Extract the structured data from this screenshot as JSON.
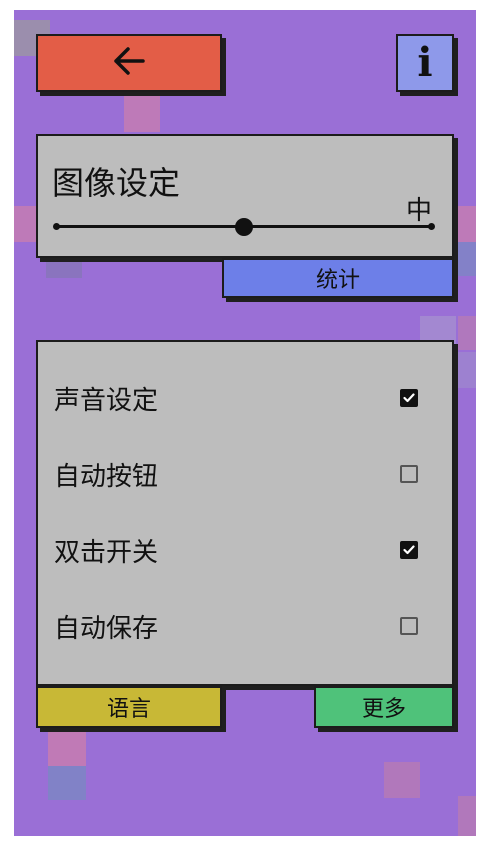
{
  "header": {
    "back_icon": "arrow-left-icon",
    "info_icon": "info-icon",
    "info_glyph": "i"
  },
  "graphics": {
    "title": "图像设定",
    "level_label": "中",
    "slider_value": 0.5,
    "stats_label": "统计"
  },
  "settings": {
    "items": [
      {
        "label": "声音设定",
        "checked": true
      },
      {
        "label": "自动按钮",
        "checked": false
      },
      {
        "label": "双击开关",
        "checked": true
      },
      {
        "label": "自动保存",
        "checked": false
      }
    ],
    "language_label": "语言",
    "more_label": "更多"
  },
  "colors": {
    "background": "#9a6fd6",
    "back_button": "#e35d47",
    "info_button": "#8e99ea",
    "stats_button": "#6d7fe8",
    "language_button": "#c8b836",
    "more_button": "#4fc27a",
    "panel": "#bdbdbd"
  }
}
